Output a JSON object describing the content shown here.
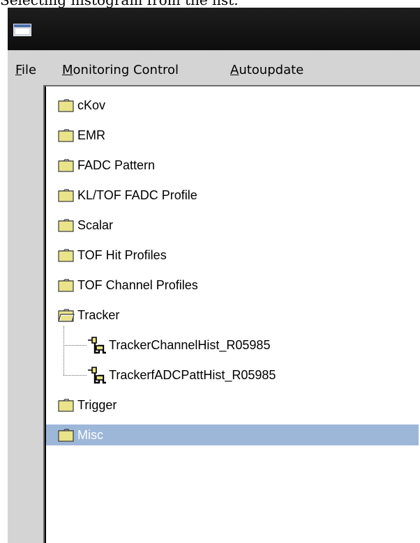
{
  "caption": "Selecting histogram from the list.",
  "menubar": {
    "file": {
      "mnemonic": "F",
      "rest": "ile"
    },
    "monitoring": {
      "mnemonic": "M",
      "rest": "onitoring Control"
    },
    "autoupdate": {
      "mnemonic": "A",
      "rest": "utoupdate"
    }
  },
  "tree": {
    "folders": [
      {
        "label": "cKov",
        "state": "closed"
      },
      {
        "label": "EMR",
        "state": "closed"
      },
      {
        "label": "FADC Pattern",
        "state": "closed"
      },
      {
        "label": "KL/TOF FADC Profile",
        "state": "closed"
      },
      {
        "label": "Scalar",
        "state": "closed"
      },
      {
        "label": "TOF Hit Profiles",
        "state": "closed"
      },
      {
        "label": "TOF Channel Profiles",
        "state": "closed"
      },
      {
        "label": "Tracker",
        "state": "open"
      },
      {
        "label": "Trigger",
        "state": "closed"
      },
      {
        "label": "Misc",
        "state": "closed",
        "selected": true
      }
    ],
    "tracker_children": [
      {
        "label": "TrackerChannelHist_R05985",
        "icon": "histogram-icon"
      },
      {
        "label": "TrackerfADCPattHist_R05985",
        "icon": "histogram-icon"
      }
    ]
  },
  "colors": {
    "titlebar": "#141414",
    "window_bg": "#d4d4d4",
    "selection": "#9db7d9",
    "folder": "#e9e48a"
  }
}
